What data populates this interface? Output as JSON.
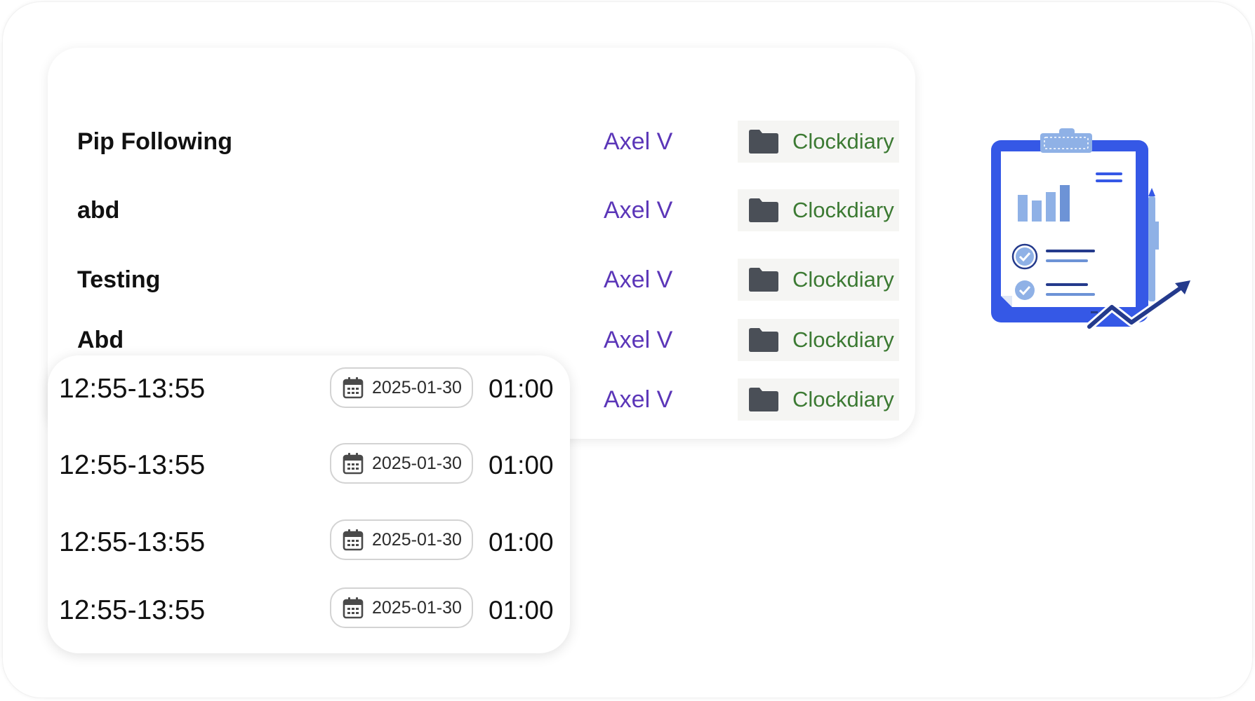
{
  "tasks": [
    {
      "name": "Pip Following",
      "user": "Axel V",
      "project": "Clockdiary"
    },
    {
      "name": "abd",
      "user": "Axel V",
      "project": "Clockdiary"
    },
    {
      "name": "Testing",
      "user": "Axel V",
      "project": "Clockdiary"
    },
    {
      "name": "Abd",
      "user": "Axel V",
      "project": "Clockdiary"
    },
    {
      "name": "",
      "user": "Axel V",
      "project": "Clockdiary"
    }
  ],
  "time_entries": [
    {
      "range": "12:55-13:55",
      "date": "2025-01-30",
      "duration": "01:00"
    },
    {
      "range": "12:55-13:55",
      "date": "2025-01-30",
      "duration": "01:00"
    },
    {
      "range": "12:55-13:55",
      "date": "2025-01-30",
      "duration": "01:00"
    },
    {
      "range": "12:55-13:55",
      "date": "2025-01-30",
      "duration": "01:00"
    }
  ],
  "icons": {
    "project": "folder-icon",
    "date": "calendar-icon",
    "illustration": "clipboard-report-icon"
  },
  "colors": {
    "user": "#5b36b8",
    "project": "#3c7a33",
    "folder": "#4a4f57",
    "clipboard": "#3558e6",
    "clipboard_light": "#8fb1e6",
    "trend_arrow": "#243a8c"
  }
}
